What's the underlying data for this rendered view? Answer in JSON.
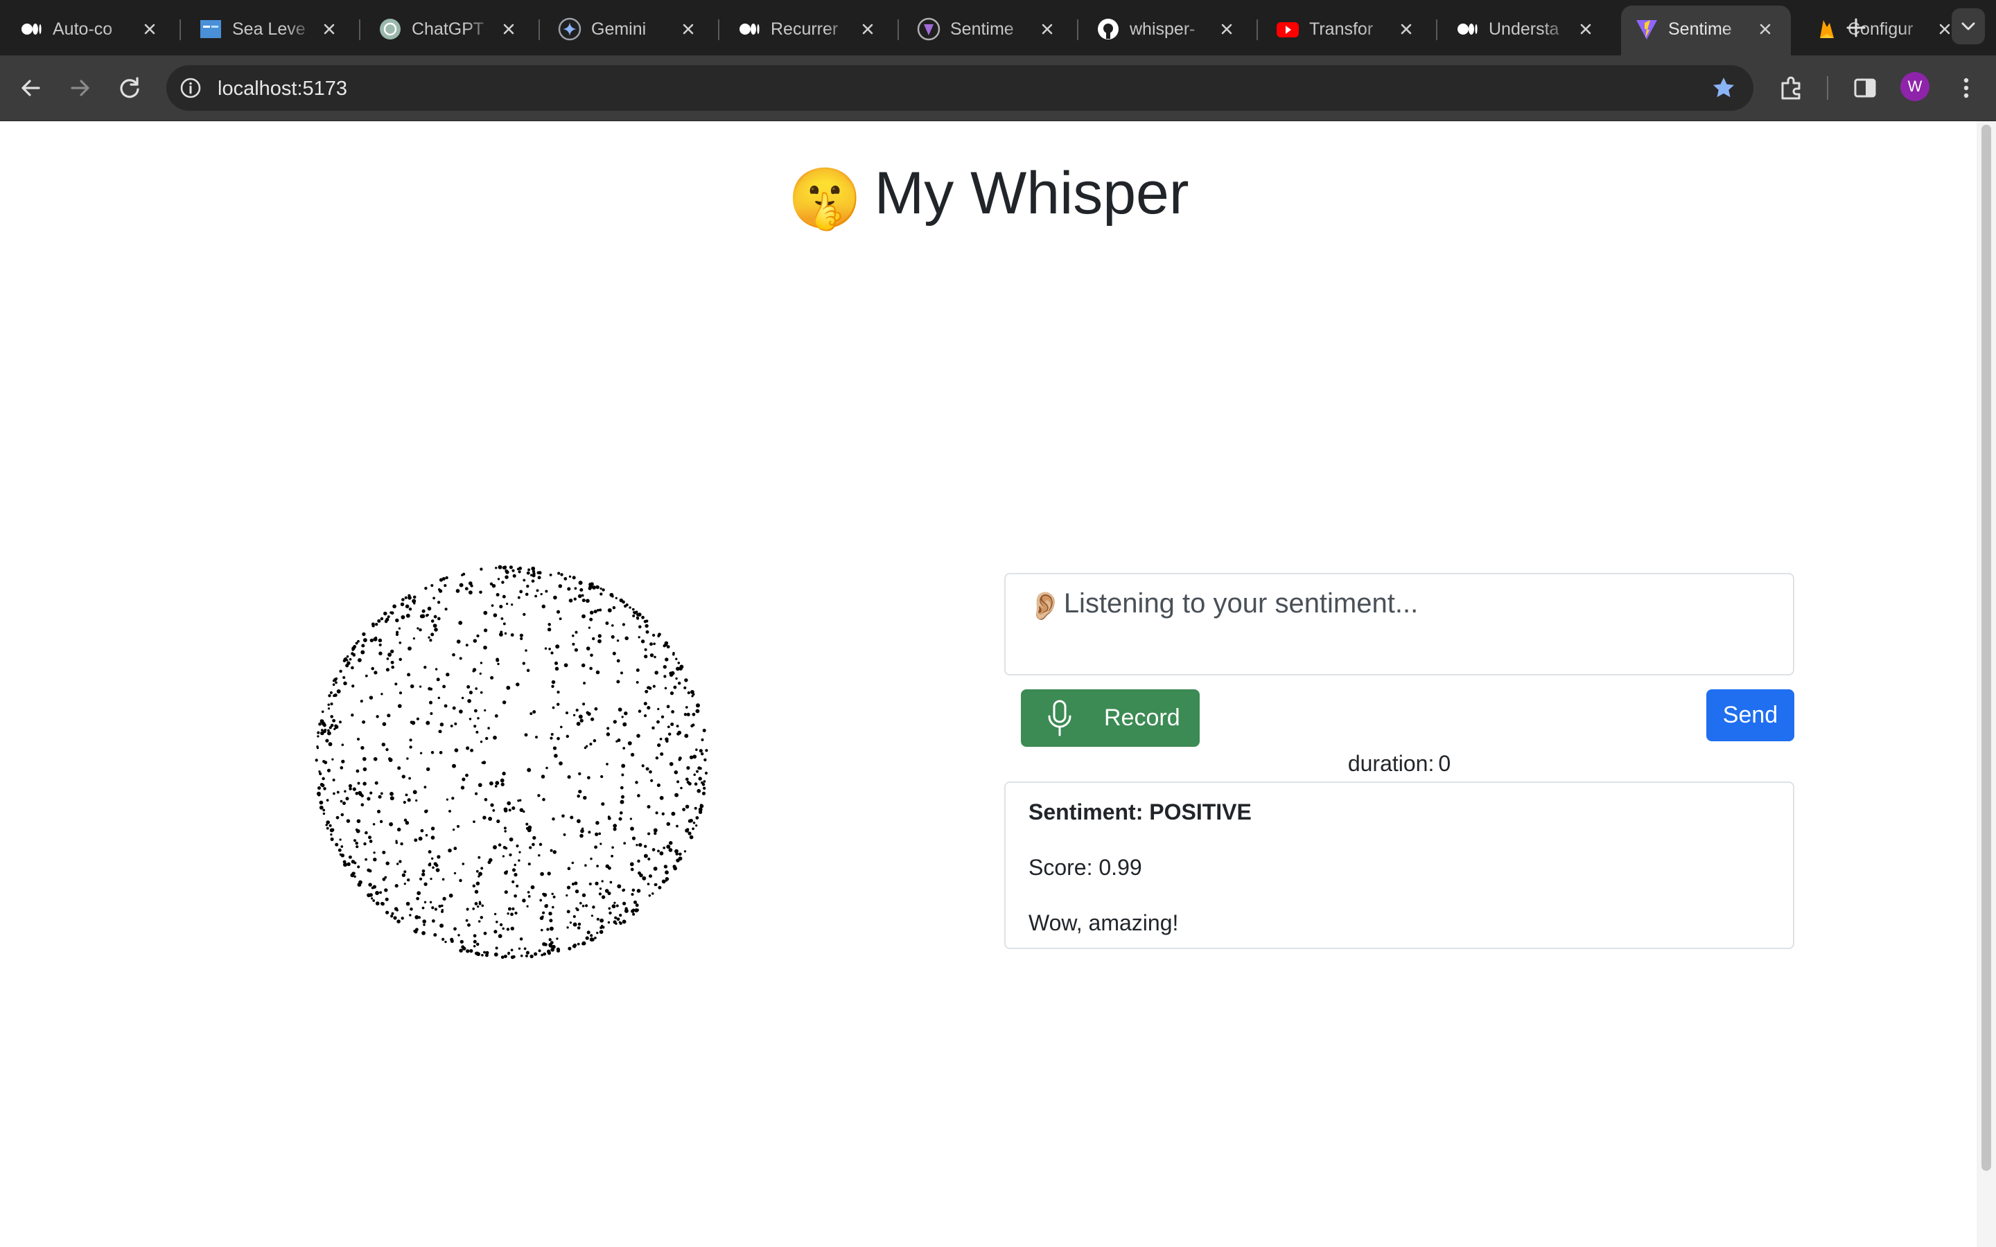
{
  "browser": {
    "tabs": [
      {
        "title": "Auto-co",
        "icon": "medium-icon",
        "active": false
      },
      {
        "title": "Sea Leve",
        "icon": "dataset-icon",
        "active": false
      },
      {
        "title": "ChatGPT",
        "icon": "chatgpt-icon",
        "active": false
      },
      {
        "title": "Gemini",
        "icon": "gemini-icon",
        "active": false
      },
      {
        "title": "Recurrer",
        "icon": "medium-icon",
        "active": false
      },
      {
        "title": "Sentime",
        "icon": "sentiment-app-icon",
        "active": false
      },
      {
        "title": "whisper-",
        "icon": "github-icon",
        "active": false
      },
      {
        "title": "Transfor",
        "icon": "youtube-icon",
        "active": false
      },
      {
        "title": "Understa",
        "icon": "medium-icon",
        "active": false
      },
      {
        "title": "Sentime",
        "icon": "vite-icon",
        "active": true
      },
      {
        "title": "Configur",
        "icon": "firebase-icon",
        "active": false
      }
    ],
    "url": "localhost:5173",
    "avatar_letter": "W",
    "colors": {
      "frame": "#1f1f1f",
      "toolbar": "#3c3c3c",
      "star": "#8ab4f8",
      "avatar": "#8e24aa"
    }
  },
  "page": {
    "title_emoji": "🤫",
    "title": "My Whisper",
    "transcript": {
      "emoji": "👂🏼",
      "text": "Listening to your sentiment..."
    },
    "record_button": {
      "label": "Record",
      "icon": "microphone-icon",
      "color": "#3c8a54"
    },
    "send_button": {
      "label": "Send",
      "color": "#1f6ff0"
    },
    "duration": {
      "label": "duration:",
      "value": "0"
    },
    "result": {
      "heading": "Sentiment: POSITIVE",
      "score": "Score: 0.99",
      "text": "Wow, amazing!"
    }
  }
}
